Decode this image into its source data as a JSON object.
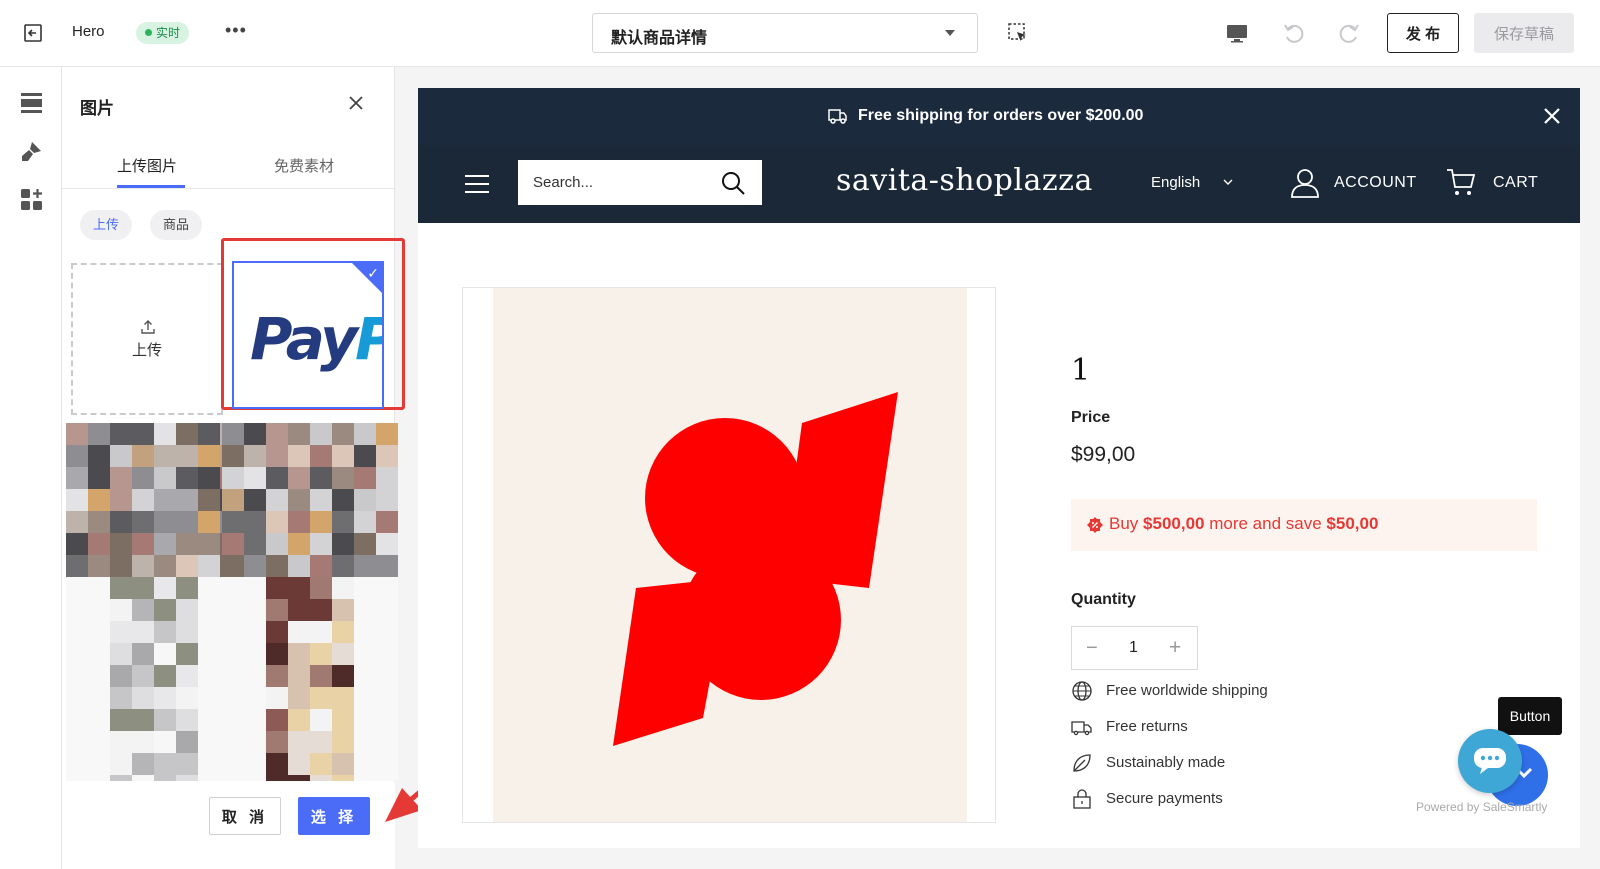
{
  "topbar": {
    "theme_name": "Hero",
    "status_badge": "实时",
    "more_label": "•••",
    "page_select_value": "默认商品详情",
    "publish_label": "发 布",
    "save_draft_label": "保存草稿"
  },
  "panel": {
    "title": "图片",
    "tabs": [
      "上传图片",
      "免费素材"
    ],
    "chips": [
      "上传",
      "商品"
    ],
    "upload_label": "上传",
    "paypal_logo_text": "PayPal",
    "cancel_label": "取 消",
    "select_label": "选 择"
  },
  "store": {
    "announcement": "Free shipping for orders over $200.00",
    "search_placeholder": "Search...",
    "brand": "savita-shoplazza",
    "language": "English",
    "account_label": "ACCOUNT",
    "cart_label": "CART"
  },
  "product": {
    "title": "1",
    "price_label": "Price",
    "price": "$99,00",
    "promo_prefix": "Buy",
    "promo_amount": "$500,00",
    "promo_middle": "more and save",
    "promo_save": "$50,00",
    "quantity_label": "Quantity",
    "quantity_value": "1",
    "features": [
      "Free worldwide shipping",
      "Free returns",
      "Sustainably made",
      "Secure payments"
    ]
  },
  "chat": {
    "tooltip": "Button",
    "powered_by": "Powered by SaleSmartly"
  },
  "colors": {
    "accent": "#4a6cf7",
    "store_header": "#1a2838",
    "promo_red": "#e53935",
    "badge_green": "#2db35d"
  }
}
